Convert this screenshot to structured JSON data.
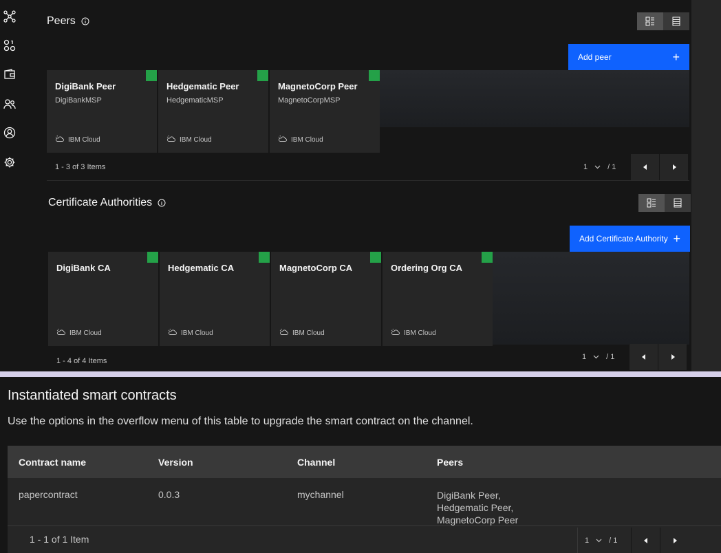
{
  "peers": {
    "title": "Peers",
    "add_button": "Add peer",
    "tiles": [
      {
        "name": "DigiBank Peer",
        "msp": "DigiBankMSP",
        "location": "IBM Cloud"
      },
      {
        "name": "Hedgematic Peer",
        "msp": "HedgematicMSP",
        "location": "IBM Cloud"
      },
      {
        "name": "MagnetoCorp Peer",
        "msp": "MagnetoCorpMSP",
        "location": "IBM Cloud"
      }
    ],
    "count": "1 - 3 of 3 Items",
    "page": "1",
    "total_pages": "/ 1"
  },
  "cas": {
    "title": "Certificate Authorities",
    "add_button": "Add Certificate Authority",
    "tiles": [
      {
        "name": "DigiBank CA",
        "location": "IBM Cloud"
      },
      {
        "name": "Hedgematic CA",
        "location": "IBM Cloud"
      },
      {
        "name": "MagnetoCorp CA",
        "location": "IBM Cloud"
      },
      {
        "name": "Ordering Org CA",
        "location": "IBM Cloud"
      }
    ],
    "count": "1 - 4 of 4 Items",
    "page": "1",
    "total_pages": "/ 1"
  },
  "contracts": {
    "title": "Instantiated smart contracts",
    "description": "Use the options in the overflow menu of this table to upgrade the smart contract on the channel.",
    "headers": [
      "Contract name",
      "Version",
      "Channel",
      "Peers"
    ],
    "rows": [
      {
        "name": "papercontract",
        "version": "0.0.3",
        "channel": "mychannel",
        "peers": [
          "DigiBank Peer,",
          "Hedgematic Peer,",
          "MagnetoCorp Peer"
        ]
      }
    ],
    "count": "1 - 1 of 1 Item",
    "page": "1",
    "total_pages": "/ 1"
  },
  "colors": {
    "accent": "#0f62fe",
    "status": "#24a148",
    "background": "#161616",
    "tile": "#262626"
  },
  "sidebar_icons": [
    "network-icon",
    "nodes-icon",
    "wallet-icon",
    "users-icon",
    "user-profile-icon",
    "settings-icon"
  ]
}
